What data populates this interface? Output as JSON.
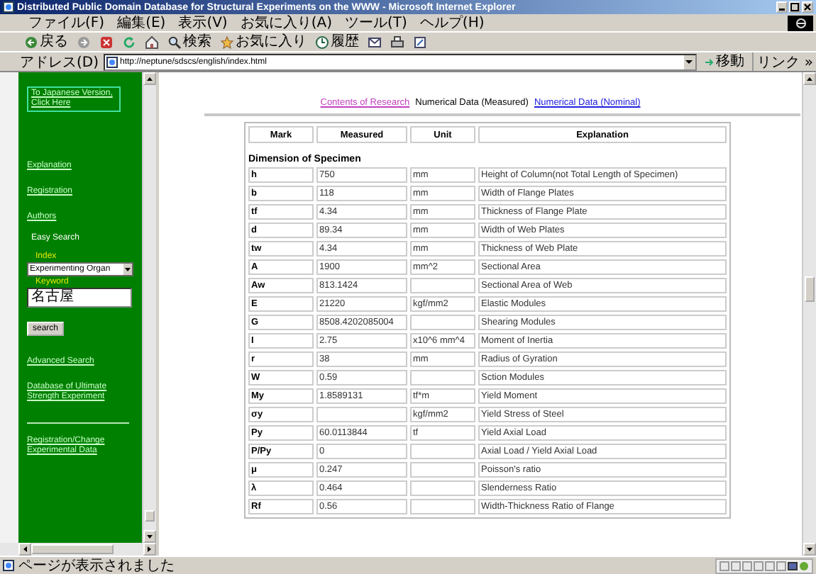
{
  "window": {
    "title": "Distributed Public Domain Database for Structural Experiments on the WWW - Microsoft Internet Explorer"
  },
  "menu": [
    "ファイル(F)",
    "編集(E)",
    "表示(V)",
    "お気に入り(A)",
    "ツール(T)",
    "ヘルプ(H)"
  ],
  "toolbar": [
    {
      "kind": "back",
      "label": "戻る"
    },
    {
      "kind": "forward"
    },
    {
      "kind": "stop"
    },
    {
      "kind": "refresh"
    },
    {
      "kind": "home"
    },
    {
      "kind": "search",
      "label": "検索"
    },
    {
      "kind": "favorites",
      "label": "お気に入り"
    },
    {
      "kind": "history",
      "label": "履歴"
    },
    {
      "kind": "mail"
    },
    {
      "kind": "print"
    },
    {
      "kind": "edit"
    }
  ],
  "address": {
    "label": "アドレス(D)",
    "value": "http://neptune/sdscs/english/index.html",
    "go": "移動",
    "links": "リンク »"
  },
  "sidebar": [
    {
      "kind": "boxed_link",
      "text": "To Japanese Version, Click Here"
    },
    {
      "kind": "link",
      "text": "Explanation"
    },
    {
      "kind": "link",
      "text": "Registration"
    },
    {
      "kind": "link",
      "text": "Authors"
    },
    {
      "kind": "heading",
      "text": "Easy Search"
    },
    {
      "kind": "label",
      "text": "Index"
    },
    {
      "kind": "select",
      "value": "Experimenting Organ"
    },
    {
      "kind": "label",
      "text": "Keyword"
    },
    {
      "kind": "input",
      "value": "名古屋"
    },
    {
      "kind": "button",
      "text": "search"
    },
    {
      "kind": "link",
      "text": "Advanced Search"
    },
    {
      "kind": "link",
      "text": "Database of Ultimate Strength Experiment"
    },
    {
      "kind": "rule"
    },
    {
      "kind": "link",
      "text": "Registration/Change Experimental Data"
    }
  ],
  "nav": [
    {
      "kind": "visited",
      "text": "Contents of Research"
    },
    {
      "kind": "current",
      "text": "Numerical Data (Measured)"
    },
    {
      "kind": "link",
      "text": "Numerical Data (Nominal)"
    }
  ],
  "table": {
    "columns": [
      "Mark",
      "Measured",
      "Unit",
      "Explanation"
    ],
    "section": "Dimension of Specimen",
    "rows": [
      {
        "mark": "h",
        "measured": "750",
        "unit": "mm",
        "explanation": "Height of Column(not Total Length of Specimen)"
      },
      {
        "mark": "b",
        "measured": "118",
        "unit": "mm",
        "explanation": "Width of Flange Plates"
      },
      {
        "mark": "tf",
        "measured": "4.34",
        "unit": "mm",
        "explanation": "Thickness of Flange Plate"
      },
      {
        "mark": "d",
        "measured": "89.34",
        "unit": "mm",
        "explanation": "Width of Web Plates"
      },
      {
        "mark": "tw",
        "measured": "4.34",
        "unit": "mm",
        "explanation": "Thickness of Web Plate"
      },
      {
        "mark": "A",
        "measured": "1900",
        "unit": "mm^2",
        "explanation": "Sectional Area"
      },
      {
        "mark": "Aw",
        "measured": "813.1424",
        "explanation": "Sectional Area of Web"
      },
      {
        "mark": "E",
        "measured": "21220",
        "unit": "kgf/mm2",
        "explanation": "Elastic Modules"
      },
      {
        "mark": "G",
        "measured": "8508.4202085004",
        "explanation": "Shearing Modules"
      },
      {
        "mark": "I",
        "measured": "2.75",
        "unit": "x10^6 mm^4",
        "explanation": "Moment of Inertia"
      },
      {
        "mark": "r",
        "measured": "38",
        "unit": "mm",
        "explanation": "Radius of Gyration"
      },
      {
        "mark": "W",
        "measured": "0.59",
        "explanation": "Sction Modules"
      },
      {
        "mark": "My",
        "measured": "1.8589131",
        "unit": "tf*m",
        "explanation": "Yield Moment"
      },
      {
        "mark": "σy",
        "unit": "kgf/mm2",
        "explanation": "Yield Stress of Steel"
      },
      {
        "mark": "Py",
        "measured": "60.0113844",
        "unit": "tf",
        "explanation": "Yield Axial Load"
      },
      {
        "mark": "P/Py",
        "measured": "0",
        "explanation": "Axial Load / Yield Axial Load"
      },
      {
        "mark": "μ",
        "measured": "0.247",
        "explanation": "Poisson's ratio"
      },
      {
        "mark": "λ",
        "measured": "0.464",
        "explanation": "Slenderness Ratio"
      },
      {
        "mark": "Rf",
        "measured": "0.56",
        "explanation": "Width-Thickness Ratio of Flange"
      }
    ]
  },
  "status": {
    "text": "ページが表示されました"
  }
}
